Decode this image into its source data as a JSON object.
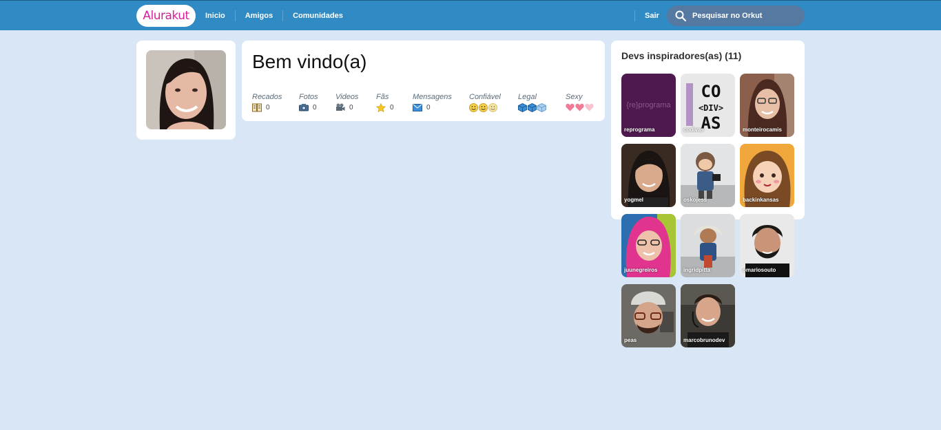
{
  "header": {
    "logo": "Alurakut",
    "nav": [
      "Inicio",
      "Amigos",
      "Comunidades"
    ],
    "logout": "Sair",
    "search_placeholder": "Pesquisar no Orkut"
  },
  "welcome": {
    "title": "Bem vindo(a)",
    "stats": [
      {
        "label": "Recados",
        "value": "0",
        "icon": "book-icon"
      },
      {
        "label": "Fotos",
        "value": "0",
        "icon": "camera-icon"
      },
      {
        "label": "Videos",
        "value": "0",
        "icon": "video-camera-icon"
      },
      {
        "label": "Fãs",
        "value": "0",
        "icon": "star-icon"
      },
      {
        "label": "Mensagens",
        "value": "0",
        "icon": "envelope-icon"
      },
      {
        "label": "Confiável",
        "icon": "smiley-icon",
        "rating": 3
      },
      {
        "label": "Legal",
        "icon": "ice-cube-icon",
        "rating": 3
      },
      {
        "label": "Sexy",
        "icon": "heart-icon",
        "rating": 3
      }
    ]
  },
  "relations": {
    "title": "Devs inspiradores(as) (11)",
    "people": [
      {
        "name": "reprograma",
        "color": "#5A1E58"
      },
      {
        "name": "codivas",
        "color": "#E8E8E8"
      },
      {
        "name": "monteirocamis",
        "color": "#8C5F4C"
      },
      {
        "name": "yogmel",
        "color": "#3A2B22"
      },
      {
        "name": "oskojess",
        "color": "#E2E4E6"
      },
      {
        "name": "backinkansas",
        "color": "#F0A83C"
      },
      {
        "name": "juunegreiros",
        "color": "#2B6FB0"
      },
      {
        "name": "ingridpitta",
        "color": "#DCDDDF"
      },
      {
        "name": "omariosouto",
        "color": "#E9E9E9"
      },
      {
        "name": "peas",
        "color": "#6D6A66"
      },
      {
        "name": "marcobrunodev",
        "color": "#3D3A36"
      }
    ]
  },
  "colors": {
    "topbar": "#308BC5",
    "brand_pink": "#D81D99",
    "background": "#D9E6F6"
  }
}
